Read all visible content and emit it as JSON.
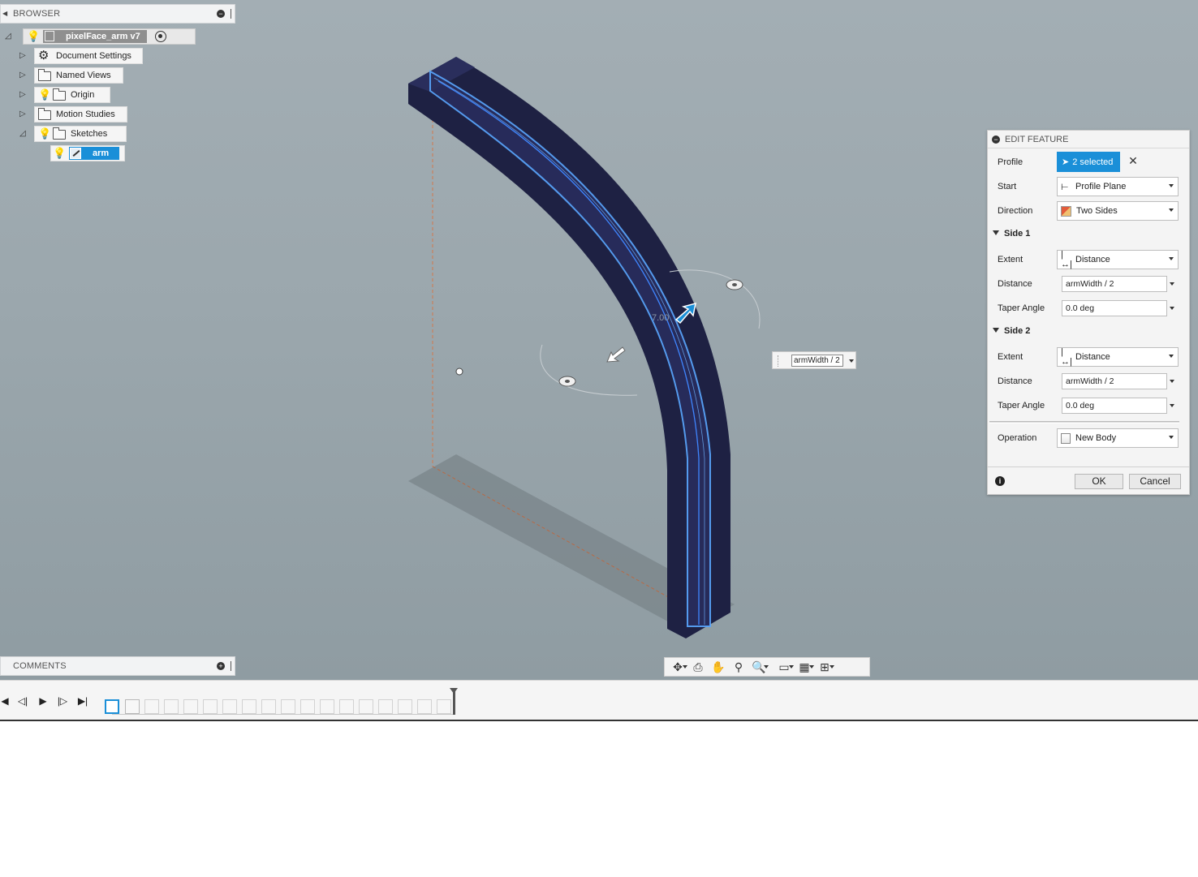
{
  "browser": {
    "header_label": "BROWSER",
    "root_label": "pixelFace_arm v7",
    "items": [
      {
        "label": "Document Settings"
      },
      {
        "label": "Named Views"
      },
      {
        "label": "Origin"
      },
      {
        "label": "Motion Studies"
      },
      {
        "label": "Sketches"
      }
    ],
    "sketch_label": "arm"
  },
  "comments": {
    "header_label": "COMMENTS"
  },
  "edit_feature": {
    "title": "EDIT FEATURE",
    "profile_label": "Profile",
    "profile_value": "2 selected",
    "start_label": "Start",
    "start_value": "Profile Plane",
    "direction_label": "Direction",
    "direction_value": "Two Sides",
    "side1_title": "Side 1",
    "side1_extent_label": "Extent",
    "side1_extent_value": "Distance",
    "side1_distance_label": "Distance",
    "side1_distance_value": "armWidth / 2",
    "side1_taper_label": "Taper Angle",
    "side1_taper_value": "0.0 deg",
    "side2_title": "Side 2",
    "side2_extent_label": "Extent",
    "side2_extent_value": "Distance",
    "side2_distance_label": "Distance",
    "side2_distance_value": "armWidth / 2",
    "side2_taper_label": "Taper Angle",
    "side2_taper_value": "0.0 deg",
    "operation_label": "Operation",
    "operation_value": "New Body",
    "ok_label": "OK",
    "cancel_label": "Cancel"
  },
  "viewport": {
    "dimension_input_value": "armWidth / 2",
    "dimension_ghost_label": "7.00"
  },
  "colors": {
    "accent": "#1a8fd8",
    "body": "#1f2245",
    "viewport_top": "#a3aeb4",
    "viewport_bottom": "#8f9ca2"
  }
}
